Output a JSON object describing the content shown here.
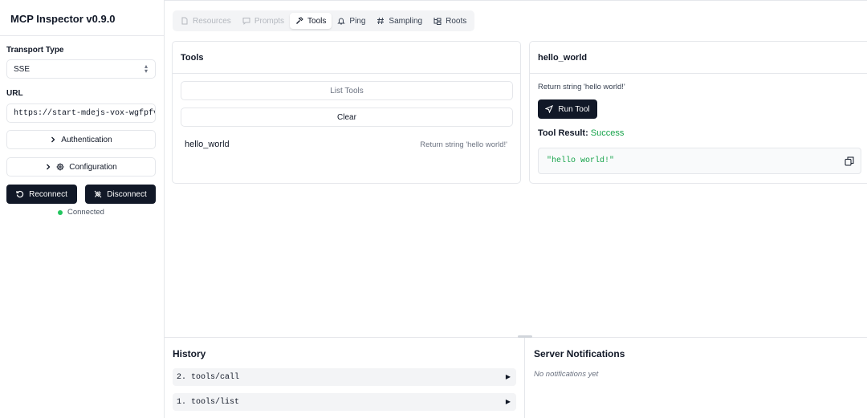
{
  "app": {
    "title": "MCP Inspector v0.9.0"
  },
  "sidebar": {
    "transport_label": "Transport Type",
    "transport_value": "SSE",
    "url_label": "URL",
    "url_value": "https://start-mdejs-vox-wgfpfvu",
    "authentication_label": "Authentication",
    "configuration_label": "Configuration",
    "reconnect_label": "Reconnect",
    "disconnect_label": "Disconnect",
    "status_text": "Connected",
    "status_color": "#22c55e"
  },
  "tabs": [
    {
      "label": "Resources",
      "icon": "file-icon",
      "state": "disabled"
    },
    {
      "label": "Prompts",
      "icon": "message-icon",
      "state": "disabled"
    },
    {
      "label": "Tools",
      "icon": "hammer-icon",
      "state": "active"
    },
    {
      "label": "Ping",
      "icon": "bell-icon",
      "state": "normal"
    },
    {
      "label": "Sampling",
      "icon": "hash-icon",
      "state": "normal"
    },
    {
      "label": "Roots",
      "icon": "folder-tree-icon",
      "state": "normal"
    }
  ],
  "tools_panel": {
    "title": "Tools",
    "list_button": "List Tools",
    "clear_button": "Clear",
    "tools": [
      {
        "name": "hello_world",
        "description": "Return string 'hello world!'"
      }
    ]
  },
  "tool_detail": {
    "title": "hello_world",
    "description": "Return string 'hello world!'",
    "run_button": "Run Tool",
    "result_label": "Tool Result:",
    "result_status": "Success",
    "result_color": "#16a34a",
    "result_json": "\"hello world!\""
  },
  "history": {
    "title": "History",
    "items": [
      {
        "label": "2. tools/call"
      },
      {
        "label": "1. tools/list"
      }
    ]
  },
  "notifications": {
    "title": "Server Notifications",
    "empty_text": "No notifications yet"
  }
}
